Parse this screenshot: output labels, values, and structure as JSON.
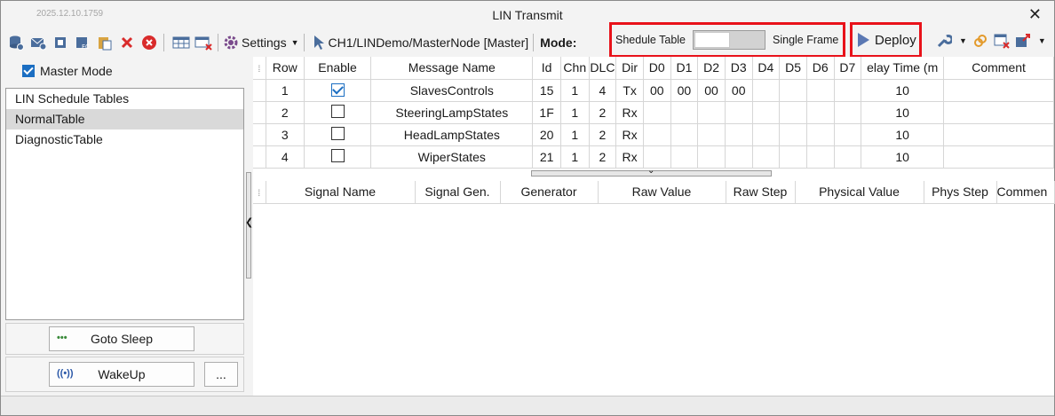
{
  "window": {
    "stamp": "2025.12.10.1759",
    "title": "LIN Transmit",
    "close_glyph": "✕"
  },
  "toolbar": {
    "settings_label": "Settings",
    "path_label": "CH1/LINDemo/MasterNode [Master]",
    "mode_label": "Mode:",
    "mode_option_left": "Shedule Table",
    "mode_option_right": "Single Frame",
    "deploy_label": "Deploy"
  },
  "left": {
    "master_mode_label": "Master Mode",
    "master_mode_checked": true,
    "tree_items": [
      "LIN Schedule Tables",
      "NormalTable",
      "DiagnosticTable"
    ],
    "selected_item": "NormalTable",
    "goto_sleep_label": "Goto Sleep",
    "wakeup_label": "WakeUp",
    "more_label": "..."
  },
  "messages": {
    "columns": [
      "Row",
      "Enable",
      "Message Name",
      "Id",
      "Chn",
      "DLC",
      "Dir",
      "D0",
      "D1",
      "D2",
      "D3",
      "D4",
      "D5",
      "D6",
      "D7",
      "elay Time (m",
      "Comment"
    ],
    "rows": [
      {
        "row": "1",
        "enable": true,
        "name": "SlavesControls",
        "id": "15",
        "chn": "1",
        "dlc": "4",
        "dir": "Tx",
        "d0": "00",
        "d1": "00",
        "d2": "00",
        "d3": "00",
        "d4": "",
        "d5": "",
        "d6": "",
        "d7": "",
        "delay": "10",
        "comment": ""
      },
      {
        "row": "2",
        "enable": false,
        "name": "SteeringLampStates",
        "id": "1F",
        "chn": "1",
        "dlc": "2",
        "dir": "Rx",
        "d0": "",
        "d1": "",
        "d2": "",
        "d3": "",
        "d4": "",
        "d5": "",
        "d6": "",
        "d7": "",
        "delay": "10",
        "comment": ""
      },
      {
        "row": "3",
        "enable": false,
        "name": "HeadLampStates",
        "id": "20",
        "chn": "1",
        "dlc": "2",
        "dir": "Rx",
        "d0": "",
        "d1": "",
        "d2": "",
        "d3": "",
        "d4": "",
        "d5": "",
        "d6": "",
        "d7": "",
        "delay": "10",
        "comment": ""
      },
      {
        "row": "4",
        "enable": false,
        "name": "WiperStates",
        "id": "21",
        "chn": "1",
        "dlc": "2",
        "dir": "Rx",
        "d0": "",
        "d1": "",
        "d2": "",
        "d3": "",
        "d4": "",
        "d5": "",
        "d6": "",
        "d7": "",
        "delay": "10",
        "comment": ""
      }
    ]
  },
  "signals": {
    "columns": [
      "Signal Name",
      "Signal Gen.",
      "Generator",
      "Raw Value",
      "Raw Step",
      "Physical Value",
      "Phys Step",
      "Commen"
    ]
  },
  "colors": {
    "highlight": "#e8121a",
    "accent": "#1b6ec2",
    "play": "#5b78b3"
  }
}
